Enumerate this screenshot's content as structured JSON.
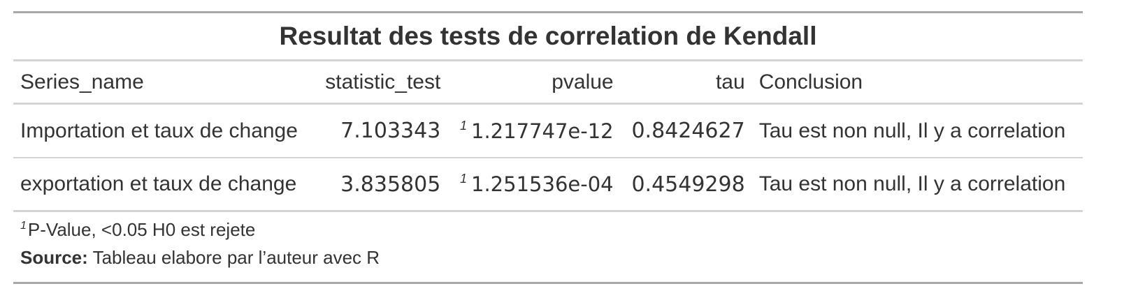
{
  "title": "Resultat des tests de correlation de Kendall",
  "columns": {
    "series_name": "Series_name",
    "statistic_test": "statistic_test",
    "pvalue": "pvalue",
    "tau": "tau",
    "conclusion": "Conclusion"
  },
  "rows": [
    {
      "series_name": "Importation et taux de change",
      "statistic_test": "7.103343",
      "pvalue_mark": "1",
      "pvalue": "1.217747e-12",
      "tau": "0.8424627",
      "conclusion": "Tau est non null, Il y a correlation"
    },
    {
      "series_name": "exportation et taux de change",
      "statistic_test": "3.835805",
      "pvalue_mark": "1",
      "pvalue": "1.251536e-04",
      "tau": "0.4549298",
      "conclusion": "Tau est non null, Il y a correlation"
    }
  ],
  "footnote": {
    "mark": "1",
    "text": "P-Value, <0.05 H0 est rejete"
  },
  "source": {
    "label": "Source:",
    "text": "Tableau elabore par l’auteur avec R"
  },
  "colors": {
    "text": "#333333",
    "outer_rule": "#a8a8a8",
    "inner_rule": "#d3d3d3"
  }
}
